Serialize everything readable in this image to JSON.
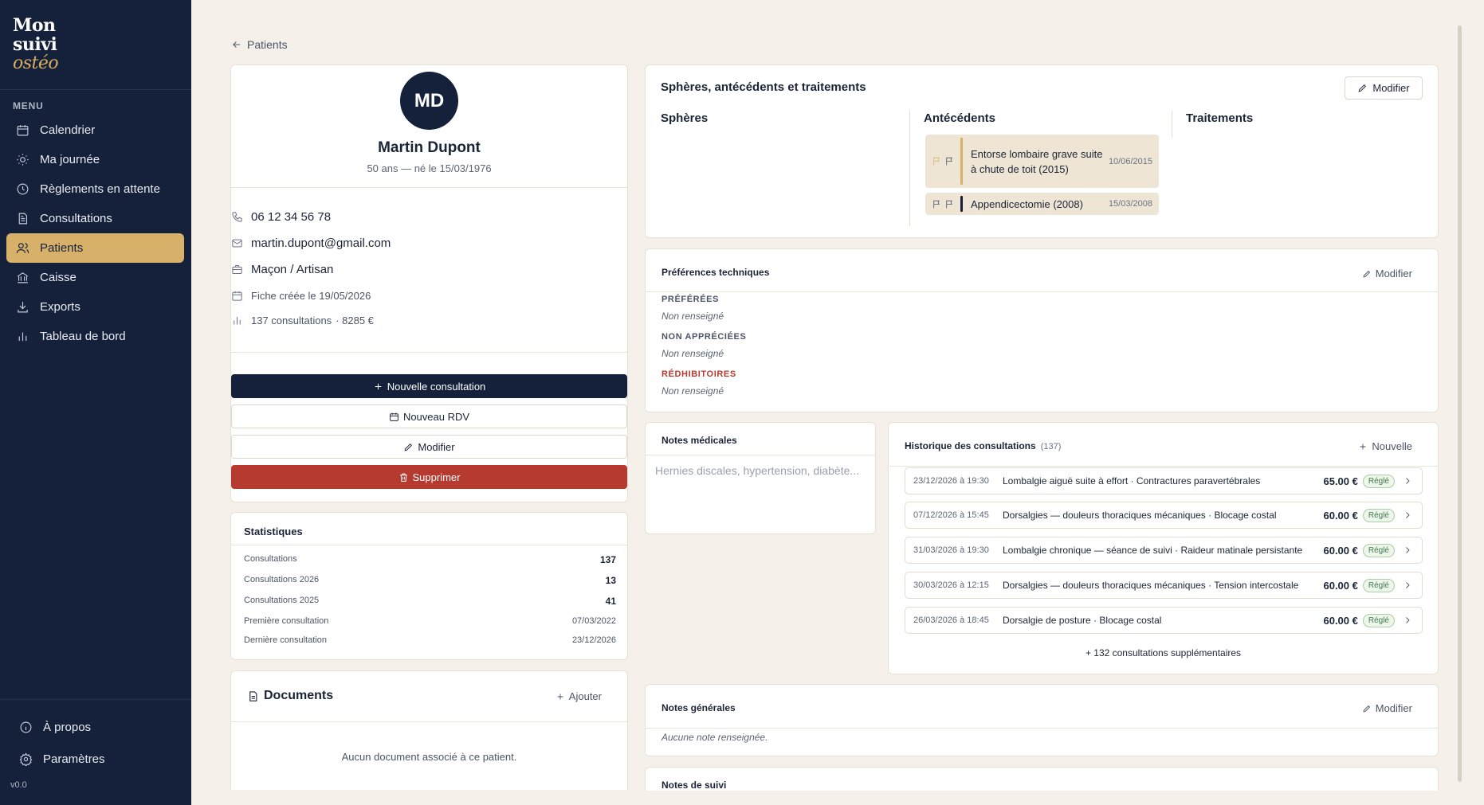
{
  "app": {
    "logo_line1": "Mon",
    "logo_line2": "suivi",
    "logo_line3": "ostéo",
    "menu_title": "MENU",
    "version": "v0.0"
  },
  "sidebar": {
    "items": [
      {
        "label": "Calendrier",
        "icon": "calendar-icon"
      },
      {
        "label": "Ma journée",
        "icon": "sun-icon"
      },
      {
        "label": "Règlements en attente",
        "icon": "clock-icon"
      },
      {
        "label": "Consultations",
        "icon": "document-icon"
      },
      {
        "label": "Patients",
        "icon": "users-icon",
        "active": true
      },
      {
        "label": "Caisse",
        "icon": "bank-icon"
      },
      {
        "label": "Exports",
        "icon": "download-icon"
      },
      {
        "label": "Tableau de bord",
        "icon": "bar-chart-icon"
      }
    ],
    "bottom": [
      {
        "label": "À propos",
        "icon": "info-icon"
      },
      {
        "label": "Paramètres",
        "icon": "gear-icon"
      }
    ]
  },
  "breadcrumb": {
    "back_label": "Patients"
  },
  "patient": {
    "initials": "MD",
    "name": "Martin Dupont",
    "age_line": "50 ans — né le 15/03/1976",
    "phone": "06 12 34 56 78",
    "email": "martin.dupont@gmail.com",
    "job": "Maçon / Artisan",
    "created": "Fiche créée le 19/05/2026",
    "consultations_summary": "137 consultations",
    "amount_summary": "· 8285 €"
  },
  "actions": {
    "new_consultation": "Nouvelle consultation",
    "new_rdv": "Nouveau RDV",
    "edit": "Modifier",
    "delete": "Supprimer"
  },
  "stats": {
    "title": "Statistiques",
    "rows": [
      {
        "label": "Consultations",
        "value": "137"
      },
      {
        "label": "Consultations 2026",
        "value": "13"
      },
      {
        "label": "Consultations 2025",
        "value": "41"
      },
      {
        "label": "Première consultation",
        "value": "07/03/2022"
      },
      {
        "label": "Dernière consultation",
        "value": "23/12/2026"
      }
    ]
  },
  "documents": {
    "title": "Documents",
    "add_label": "Ajouter",
    "empty": "Aucun document associé à ce patient."
  },
  "spheres": {
    "title": "Sphères, antécédents et traitements",
    "edit_label": "Modifier",
    "col_spheres": "Sphères",
    "col_antecedents": "Antécédents",
    "col_traitements": "Traitements",
    "antecedents": [
      {
        "text": "Entorse lombaire grave suite à chute de toit (2015)",
        "date": "10/06/2015",
        "bar_color": "#d7b06a",
        "flag_color": "#d7b06a"
      },
      {
        "text": "Appendicectomie (2008)",
        "date": "15/03/2008",
        "bar_color": "#15213a",
        "flag_color": "#4b5466"
      }
    ]
  },
  "preferences": {
    "title": "Préférences techniques",
    "edit_label": "Modifier",
    "preferred_label": "PRÉFÉRÉES",
    "preferred_value": "Non renseigné",
    "unappreciated_label": "NON APPRÉCIÉES",
    "unappreciated_value": "Non renseigné",
    "prohibitive_label": "RÉDHIBITOIRES",
    "prohibitive_value": "Non renseigné"
  },
  "medical_notes": {
    "title": "Notes médicales",
    "placeholder": "Hernies discales, hypertension, diabète..."
  },
  "history": {
    "title": "Historique des consultations",
    "count": "(137)",
    "new_label": "Nouvelle",
    "rows": [
      {
        "date": "23/12/2026 à 19:30",
        "text": "Lombalgie aiguë suite à effort · Contractures paravertébrales",
        "amount": "65.00 €",
        "status": "Réglé"
      },
      {
        "date": "07/12/2026 à 15:45",
        "text": "Dorsalgies — douleurs thoraciques mécaniques · Blocage costal",
        "amount": "60.00 €",
        "status": "Réglé"
      },
      {
        "date": "31/03/2026 à 19:30",
        "text": "Lombalgie chronique — séance de suivi · Raideur matinale persistante",
        "amount": "60.00 €",
        "status": "Réglé"
      },
      {
        "date": "30/03/2026 à 12:15",
        "text": "Dorsalgies — douleurs thoraciques mécaniques · Tension intercostale",
        "amount": "60.00 €",
        "status": "Réglé"
      },
      {
        "date": "26/03/2026 à 18:45",
        "text": "Dorsalgie de posture · Blocage costal",
        "amount": "60.00 €",
        "status": "Réglé"
      }
    ],
    "more": "+ 132 consultations supplémentaires"
  },
  "general_notes": {
    "title": "Notes générales",
    "edit_label": "Modifier",
    "empty": "Aucune note renseignée."
  },
  "followup_notes": {
    "title": "Notes de suivi"
  }
}
